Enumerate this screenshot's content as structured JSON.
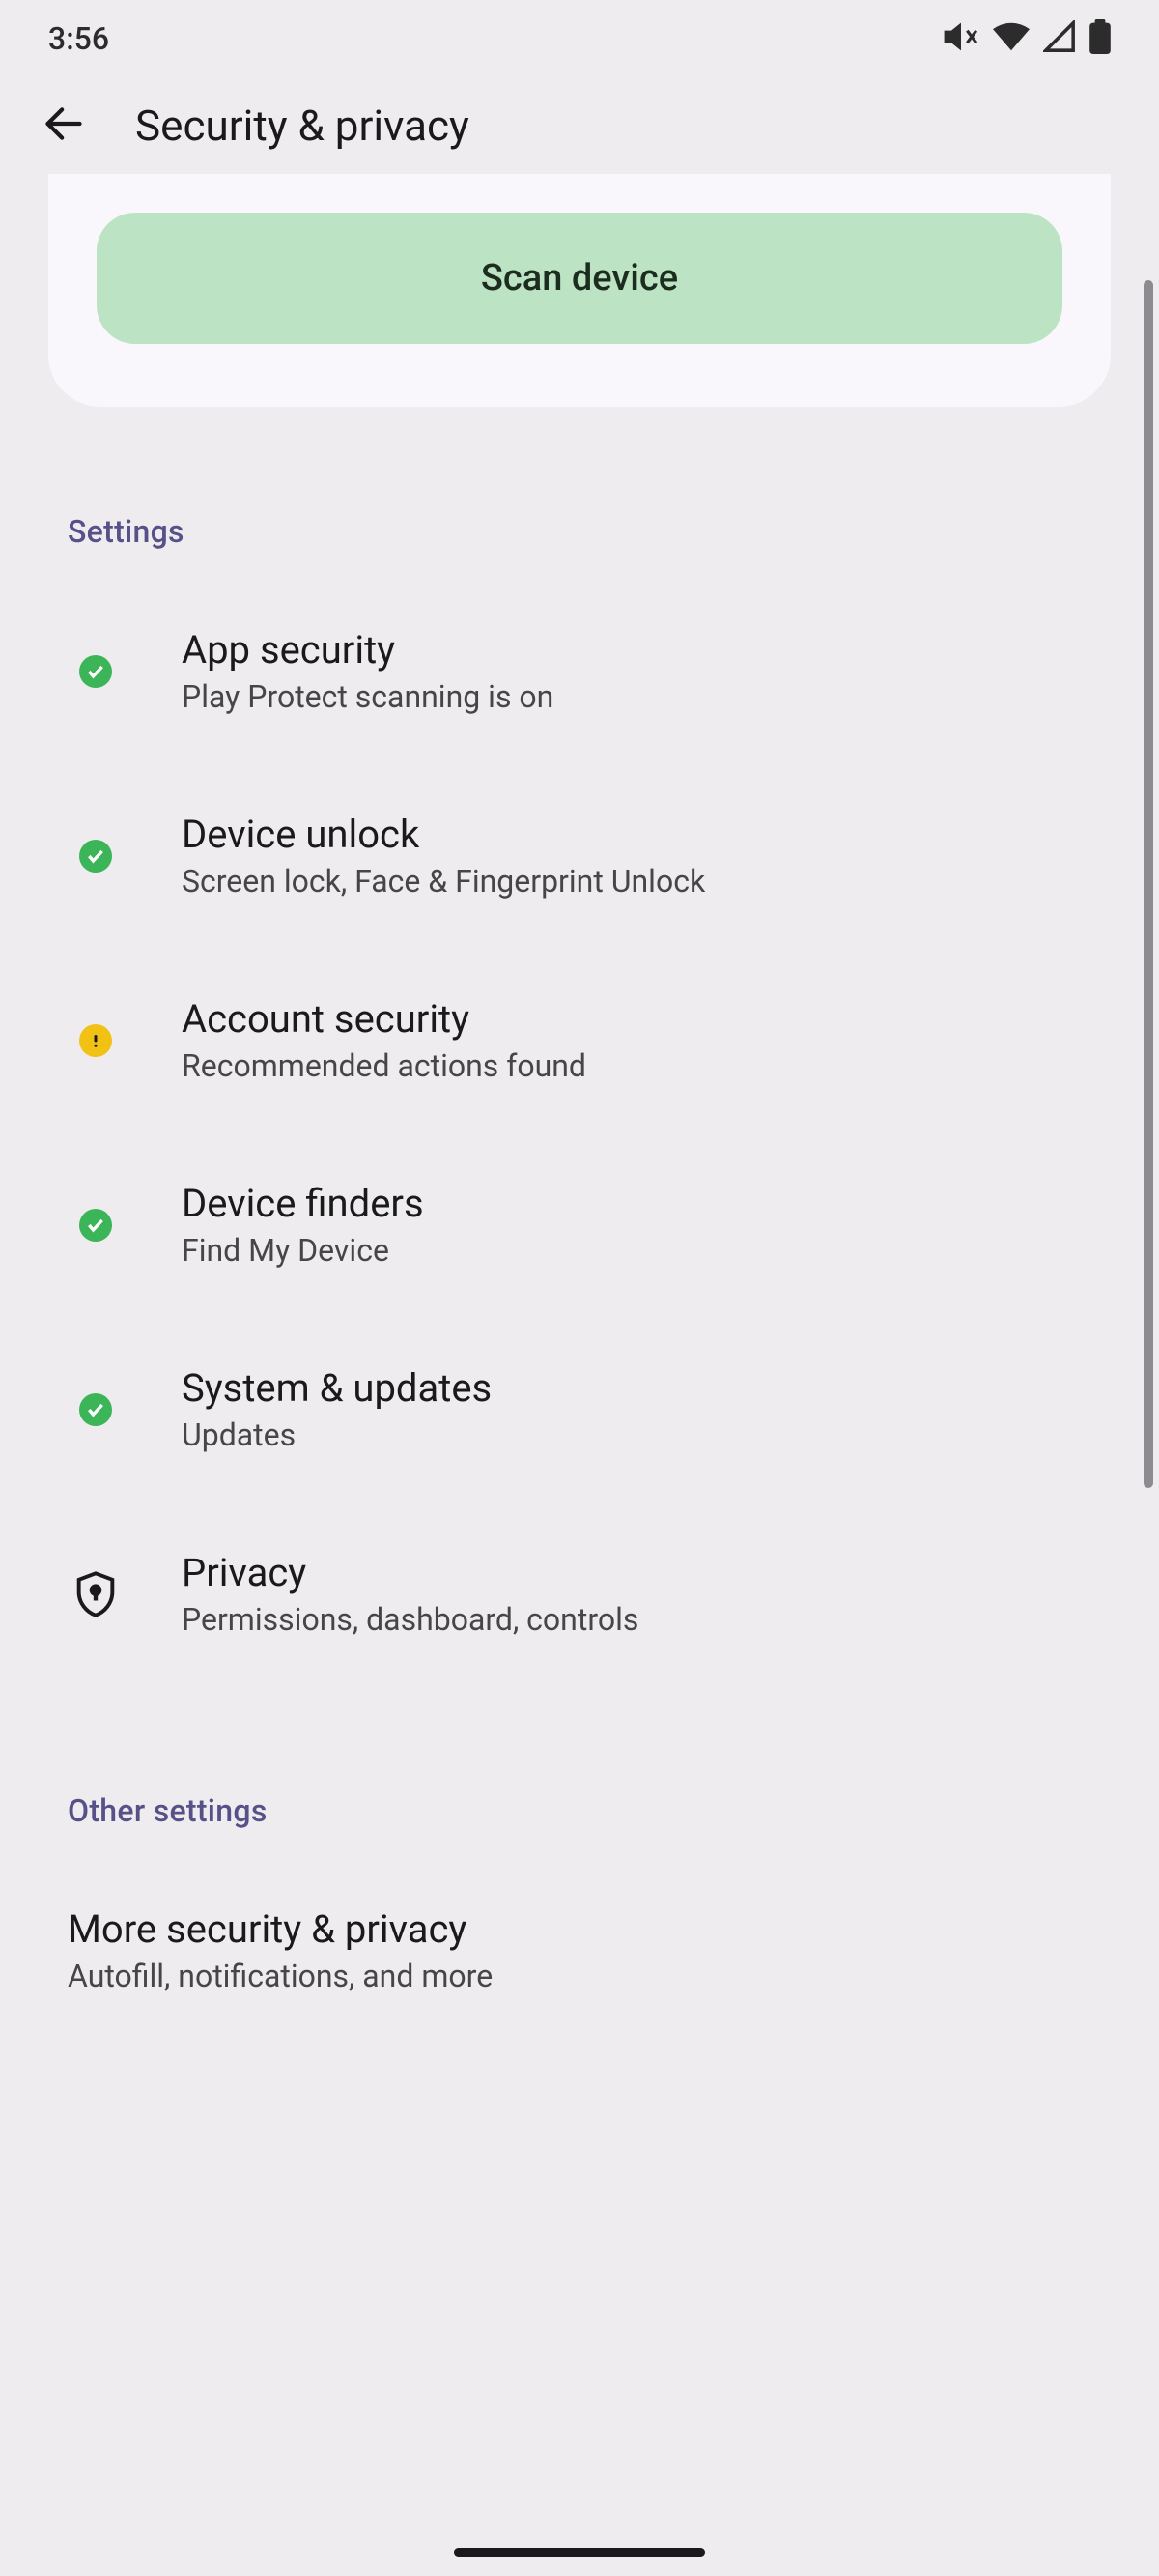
{
  "status": {
    "time": "3:56"
  },
  "header": {
    "title": "Security & privacy"
  },
  "card": {
    "scan_button_label": "Scan device"
  },
  "sections": {
    "settings_header": "Settings",
    "other_header": "Other settings",
    "items": [
      {
        "title": "App security",
        "subtitle": "Play Protect scanning is on",
        "status": "ok"
      },
      {
        "title": "Device unlock",
        "subtitle": "Screen lock, Face & Fingerprint Unlock",
        "status": "ok"
      },
      {
        "title": "Account security",
        "subtitle": "Recommended actions found",
        "status": "warn"
      },
      {
        "title": "Device finders",
        "subtitle": "Find My Device",
        "status": "ok"
      },
      {
        "title": "System & updates",
        "subtitle": "Updates",
        "status": "ok"
      },
      {
        "title": "Privacy",
        "subtitle": "Permissions, dashboard, controls",
        "status": "icon"
      }
    ],
    "other_items": [
      {
        "title": "More security & privacy",
        "subtitle": "Autofill, notifications, and more"
      }
    ]
  }
}
